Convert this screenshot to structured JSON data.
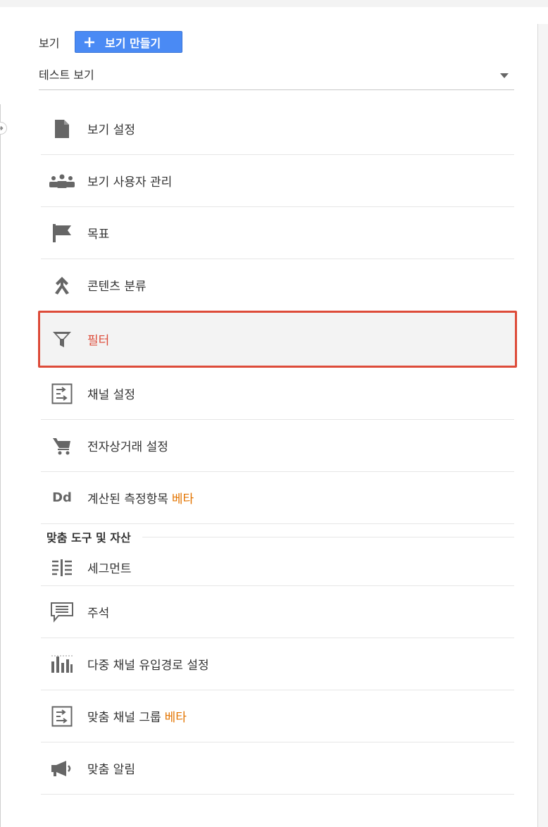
{
  "header": {
    "view_label": "보기",
    "create_button_label": "보기 만들기"
  },
  "view_selector": {
    "selected": "테스트 보기"
  },
  "menu_items": [
    {
      "label": "보기 설정",
      "icon": "document-icon"
    },
    {
      "label": "보기 사용자 관리",
      "icon": "users-icon"
    },
    {
      "label": "목표",
      "icon": "flag-icon"
    },
    {
      "label": "콘텐츠 분류",
      "icon": "content-grouping-icon"
    },
    {
      "label": "필터",
      "icon": "filter-icon",
      "active": true
    },
    {
      "label": "채널 설정",
      "icon": "channel-settings-icon"
    },
    {
      "label": "전자상거래 설정",
      "icon": "cart-icon"
    },
    {
      "label": "계산된 측정항목",
      "icon_text": "Dd",
      "badge": "베타"
    }
  ],
  "section": {
    "title": "맞춤 도구 및 자산"
  },
  "tool_items": [
    {
      "label": "세그먼트",
      "icon": "segments-icon"
    },
    {
      "label": "주석",
      "icon": "annotation-icon"
    },
    {
      "label": "다중 채널 유입경로 설정",
      "icon": "bar-chart-icon"
    },
    {
      "label": "맞춤 채널 그룹",
      "icon": "channel-group-icon",
      "badge": "베타"
    },
    {
      "label": "맞춤 알림",
      "icon": "megaphone-icon"
    }
  ],
  "colors": {
    "accent": "#4a8af4",
    "active_border": "#dd4b39",
    "beta": "#e37400"
  }
}
